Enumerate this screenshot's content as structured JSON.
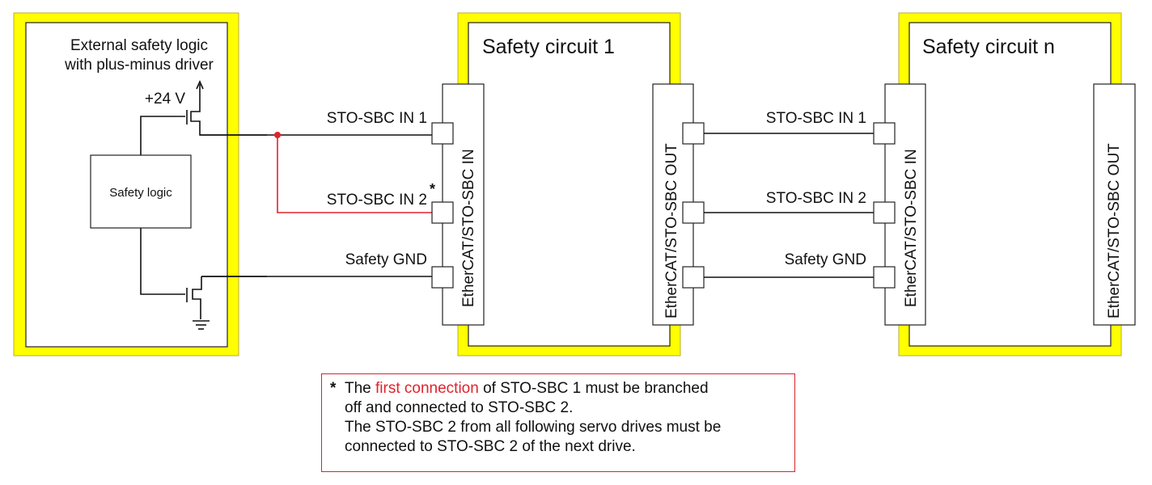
{
  "colors": {
    "frame": "#ffff00",
    "frame_edge": "#b8ac3a",
    "wire": "#111111",
    "branch": "#e0232c",
    "note_border": "#d4262e"
  },
  "external": {
    "title_line1": "External safety logic",
    "title_line2": "with plus-minus driver",
    "supply_label": "+24 V",
    "logic_block_label": "Safety logic"
  },
  "circuit1": {
    "title": "Safety circuit 1",
    "in_connector_label": "EtherCAT/STO-SBC IN",
    "out_connector_label": "EtherCAT/STO-SBC OUT"
  },
  "circuitn": {
    "title": "Safety circuit n",
    "in_connector_label": "EtherCAT/STO-SBC IN",
    "out_connector_label": "EtherCAT/STO-SBC OUT"
  },
  "signals_left": {
    "in1": "STO-SBC IN 1",
    "in2": "STO-SBC IN 2",
    "in2_marker": "*",
    "gnd": "Safety GND"
  },
  "signals_right": {
    "in1": "STO-SBC IN 1",
    "in2": "STO-SBC IN 2",
    "gnd": "Safety GND"
  },
  "note": {
    "marker": "*",
    "text_before": "The ",
    "highlight": "first connection",
    "text_after": " of STO-SBC 1 must be branched",
    "line2": "off and connected to STO-SBC 2.",
    "line3": "The STO-SBC 2 from all following servo drives must be",
    "line4": "connected to STO-SBC 2 of the next drive."
  }
}
